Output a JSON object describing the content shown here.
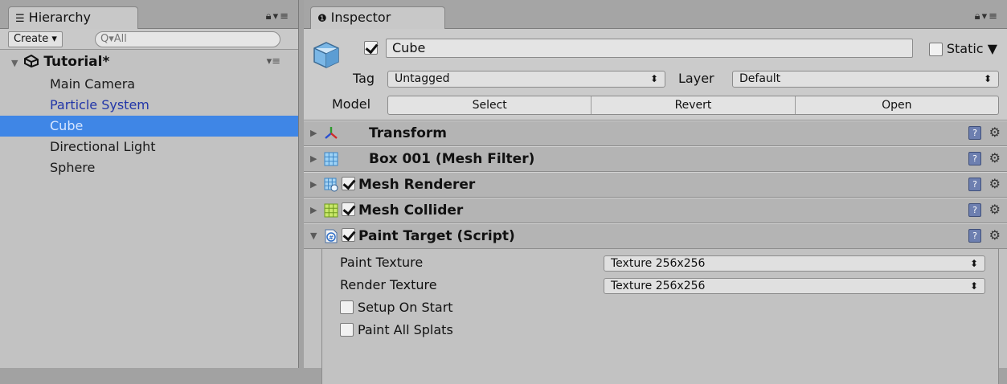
{
  "hierarchy": {
    "tab_label": "Hierarchy",
    "tab_icon": "list-icon",
    "create_label": "Create ▾",
    "search_placeholder": "Q▾All",
    "scene_name": "Tutorial*",
    "items": [
      {
        "label": "Main Camera",
        "state": "normal"
      },
      {
        "label": "Particle System",
        "state": "prefab"
      },
      {
        "label": "Cube",
        "state": "selected"
      },
      {
        "label": "Directional Light",
        "state": "normal"
      },
      {
        "label": "Sphere",
        "state": "normal"
      }
    ]
  },
  "inspector": {
    "tab_label": "Inspector",
    "tab_icon": "info-icon",
    "object": {
      "active": true,
      "name": "Cube",
      "static_label": "Static",
      "static_checked": false,
      "tag_label": "Tag",
      "tag_value": "Untagged",
      "layer_label": "Layer",
      "layer_value": "Default",
      "model_label": "Model",
      "model_buttons": [
        "Select",
        "Revert",
        "Open"
      ]
    },
    "components": [
      {
        "name": "Transform",
        "icon": "transform-axes-icon",
        "has_checkbox": false,
        "expanded": false
      },
      {
        "name": "Box 001 (Mesh Filter)",
        "icon": "mesh-filter-grid-icon",
        "has_checkbox": false,
        "expanded": false
      },
      {
        "name": "Mesh Renderer",
        "icon": "mesh-renderer-icon",
        "has_checkbox": true,
        "checked": true,
        "expanded": false
      },
      {
        "name": "Mesh Collider",
        "icon": "mesh-collider-icon",
        "has_checkbox": true,
        "checked": true,
        "expanded": false
      },
      {
        "name": "Paint Target (Script)",
        "icon": "script-icon",
        "has_checkbox": true,
        "checked": true,
        "expanded": true
      }
    ],
    "paint_target": {
      "paint_texture_label": "Paint Texture",
      "paint_texture_value": "Texture 256x256",
      "render_texture_label": "Render Texture",
      "render_texture_value": "Texture 256x256",
      "setup_on_start_label": "Setup On Start",
      "setup_on_start_checked": false,
      "paint_all_splats_label": "Paint All Splats",
      "paint_all_splats_checked": false
    }
  }
}
